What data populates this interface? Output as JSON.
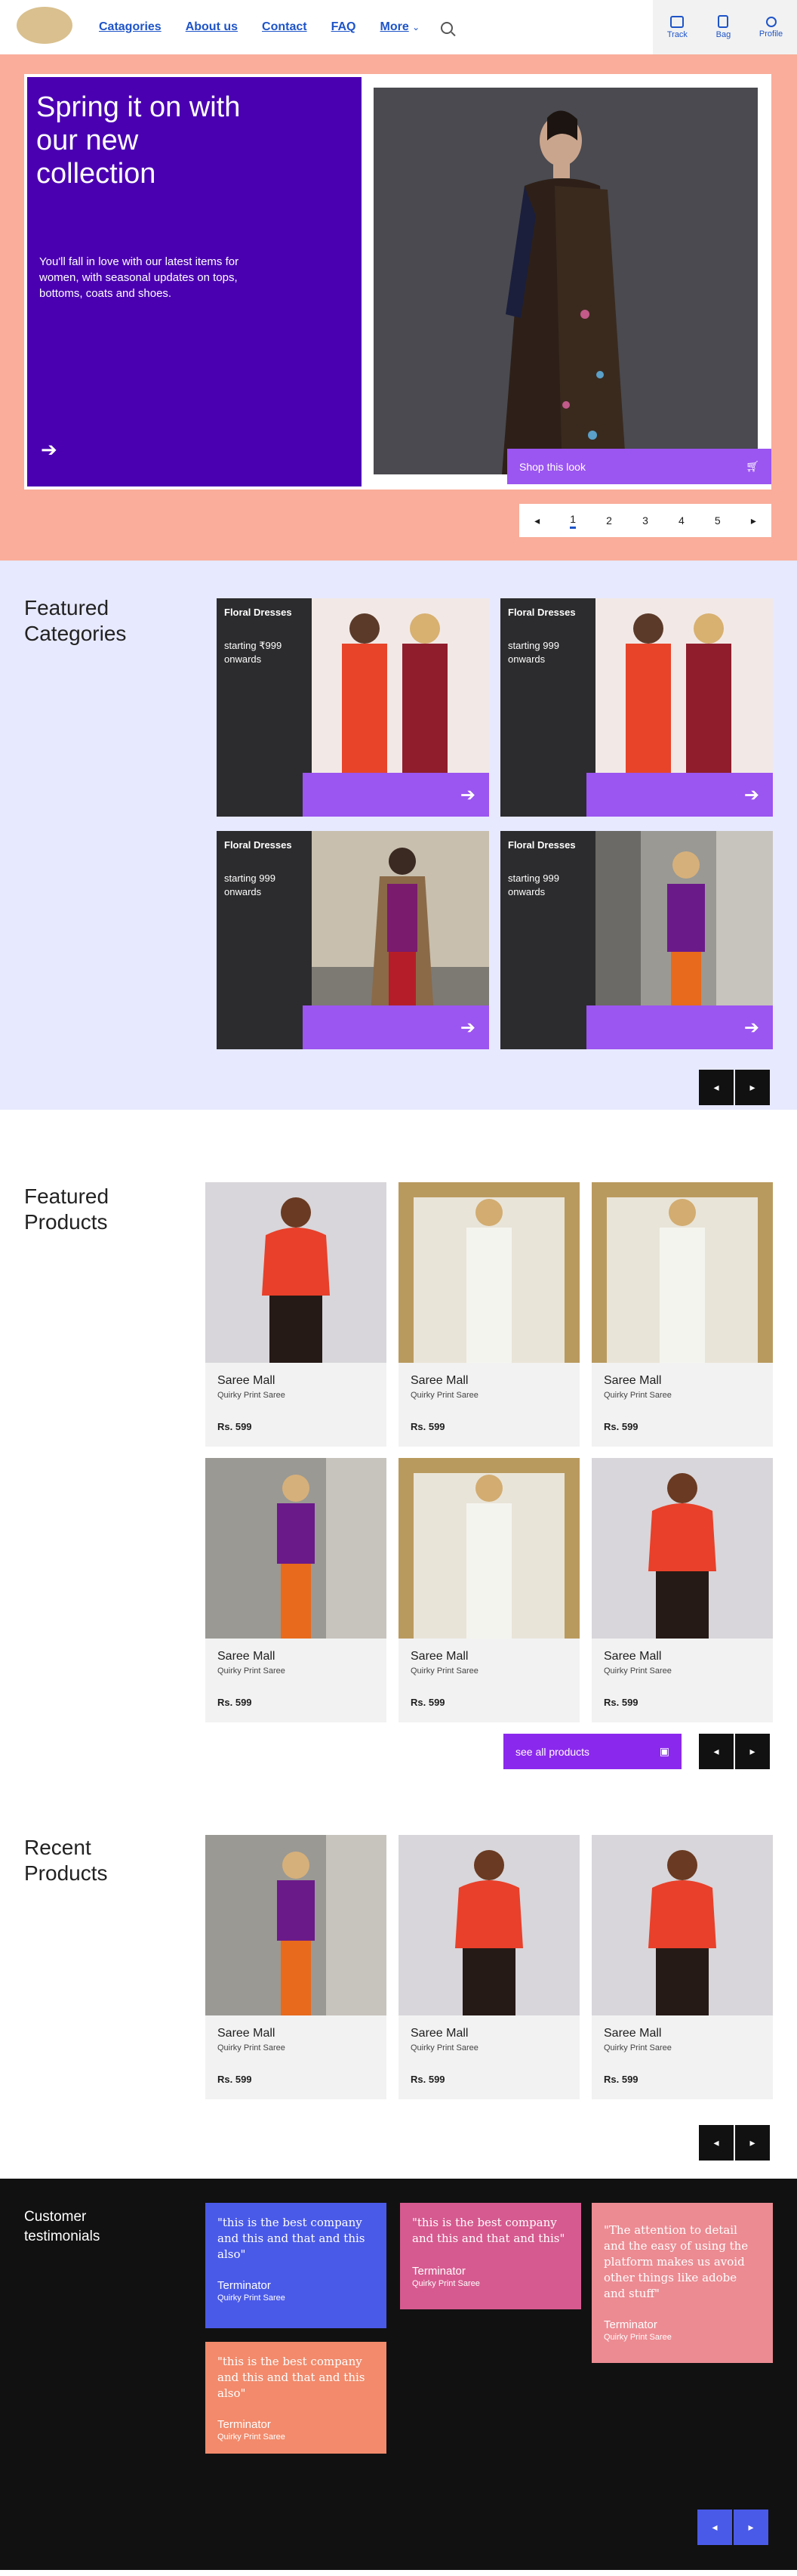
{
  "nav": {
    "categories": "Catagories",
    "about": "About us",
    "contact": "Contact",
    "faq": "FAQ",
    "more": "More",
    "track": "Track",
    "bag": "Bag",
    "profile": "Profile"
  },
  "hero": {
    "title": "Spring it on with our new collection",
    "description": "You'll fall in love with our latest items for women, with seasonal updates on tops, bottoms, coats and shoes.",
    "shop_label": "Shop this look",
    "pages": [
      "1",
      "2",
      "3",
      "4",
      "5"
    ],
    "active_page": "1"
  },
  "featured_categories": {
    "title": "Featured Categories",
    "cards": [
      {
        "title": "Floral Dresses",
        "sub": "starting ₹999 onwards"
      },
      {
        "title": "Floral Dresses",
        "sub": "starting 999 onwards"
      },
      {
        "title": "Floral Dresses",
        "sub": "starting 999 onwards"
      },
      {
        "title": "Floral Dresses",
        "sub": "starting 999 onwards"
      }
    ]
  },
  "featured_products": {
    "title": "Featured Products",
    "see_all": "see all products",
    "items": [
      {
        "name": "Saree Mall",
        "sub": "Quirky Print Saree",
        "price": "Rs. 599"
      },
      {
        "name": "Saree Mall",
        "sub": "Quirky Print Saree",
        "price": "Rs. 599"
      },
      {
        "name": "Saree Mall",
        "sub": "Quirky Print Saree",
        "price": "Rs. 599"
      },
      {
        "name": "Saree Mall",
        "sub": "Quirky Print Saree",
        "price": "Rs. 599"
      },
      {
        "name": "Saree Mall",
        "sub": "Quirky Print Saree",
        "price": "Rs. 599"
      },
      {
        "name": "Saree Mall",
        "sub": "Quirky Print Saree",
        "price": "Rs. 599"
      }
    ]
  },
  "recent_products": {
    "title": "Recent Products",
    "items": [
      {
        "name": "Saree Mall",
        "sub": "Quirky Print Saree",
        "price": "Rs. 599"
      },
      {
        "name": "Saree Mall",
        "sub": "Quirky Print Saree",
        "price": "Rs. 599"
      },
      {
        "name": "Saree Mall",
        "sub": "Quirky Print Saree",
        "price": "Rs. 599"
      }
    ]
  },
  "testimonials": {
    "title": "Customer testimonials",
    "cards": [
      {
        "quote": "\"this is the best company and this and that and this also\"",
        "name": "Terminator",
        "role": "Quirky Print Saree",
        "color": "#4a5ae8"
      },
      {
        "quote": "\"this is the best company and this and that and this\"",
        "name": "Terminator",
        "role": "Quirky Print Saree",
        "color": "#d65a8f"
      },
      {
        "quote": "\"The attention to detail and the easy of using the platform makes us avoid other things like adobe and stuff\"",
        "name": "Terminator",
        "role": "Quirky Print Saree",
        "color": "#ec8b92"
      },
      {
        "quote": "\"this is the best company and this and that and this also\"",
        "name": "Terminator",
        "role": "Quirky Print Saree",
        "color": "#f28a6b"
      }
    ]
  },
  "colors": {
    "accent_blue": "#1e54c8",
    "hero_bg": "#f9ad9a",
    "hero_card": "#4a00b1",
    "purple": "#9b55f0",
    "lavender": "#e7e9fe",
    "testimonial_blue": "#4a5ae8"
  }
}
